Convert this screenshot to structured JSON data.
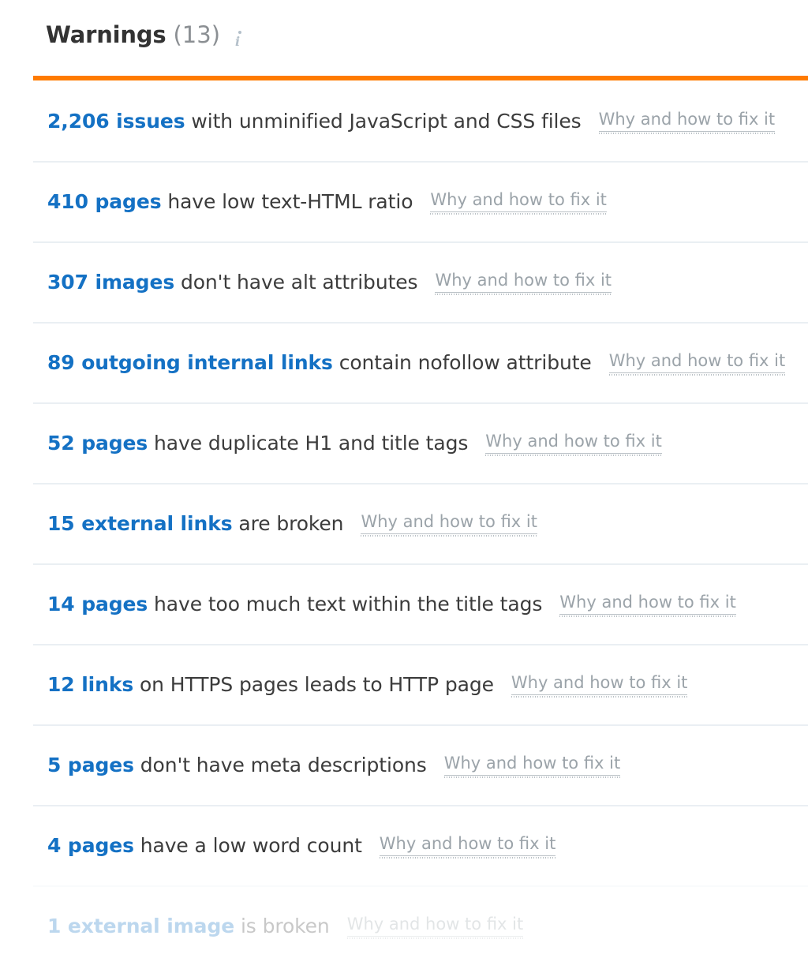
{
  "header": {
    "title": "Warnings",
    "count": "(13)",
    "info_icon": "info-icon"
  },
  "colors": {
    "accent_bar": "#ff7b00",
    "count_link": "#1471c4",
    "body_text": "#3c3c3c",
    "fix_link": "#9ba3a9",
    "separator": "#eaeff3",
    "title": "#333333",
    "count_muted": "#8b8f93"
  },
  "fix_link_label": "Why and how to fix it",
  "issues": [
    {
      "count": "2,206 issues",
      "description": " with unminified JavaScript and CSS files",
      "fix": "Why and how to fix it",
      "faded": false
    },
    {
      "count": "410 pages",
      "description": " have low text-HTML ratio",
      "fix": "Why and how to fix it",
      "faded": false
    },
    {
      "count": "307 images",
      "description": " don't have alt attributes",
      "fix": "Why and how to fix it",
      "faded": false
    },
    {
      "count": "89 outgoing internal links",
      "description": " contain nofollow attribute",
      "fix": "Why and how to fix it",
      "faded": false
    },
    {
      "count": "52 pages",
      "description": " have duplicate H1 and title tags",
      "fix": "Why and how to fix it",
      "faded": false
    },
    {
      "count": "15 external links",
      "description": " are broken",
      "fix": "Why and how to fix it",
      "faded": false
    },
    {
      "count": "14 pages",
      "description": " have too much text within the title tags",
      "fix": "Why and how to fix it",
      "faded": false
    },
    {
      "count": "12 links",
      "description": " on HTTPS pages leads to HTTP page",
      "fix": "Why and how to fix it",
      "faded": false
    },
    {
      "count": "5 pages",
      "description": " don't have meta descriptions",
      "fix": "Why and how to fix it",
      "faded": false
    },
    {
      "count": "4 pages",
      "description": " have a low word count",
      "fix": "Why and how to fix it",
      "faded": false
    },
    {
      "count": "1 external image",
      "description": " is broken",
      "fix": "Why and how to fix it",
      "faded": true
    }
  ]
}
